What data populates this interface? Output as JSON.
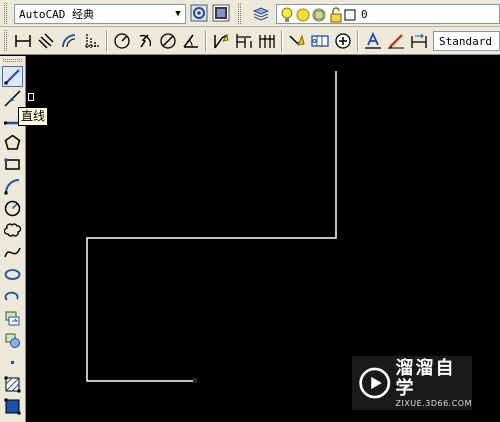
{
  "toolbar_top": {
    "workspace_value": "AutoCAD 经典",
    "layer_value": "0"
  },
  "dimension_toolbar": {
    "style_value": "Standard"
  },
  "draw_toolbar": {
    "tooltip": "直线"
  },
  "watermark": {
    "title": "溜溜自学",
    "url": "ZIXUE.3D66.COM"
  },
  "colors": {
    "toolbar_bg": "#ece9d8",
    "canvas_bg": "#000000",
    "line": "#ffffff",
    "icon_blue": "#1f4fa8"
  },
  "icons": {
    "top": [
      "workspace-settings-icon",
      "workspace-icon",
      "layer-manager-icon",
      "lightbulb-icon",
      "sun-icon",
      "layer-color-icon",
      "lock-icon",
      "color-square-icon"
    ],
    "dimension": [
      "linear-dim-icon",
      "aligned-dim-icon",
      "arc-length-icon",
      "ordinate-dim-icon",
      "radius-dim-icon",
      "jogged-dim-icon",
      "diameter-dim-icon",
      "angular-dim-icon",
      "quick-dim-icon",
      "baseline-dim-icon",
      "continue-dim-icon",
      "quick-leader-icon",
      "tolerance-icon",
      "center-mark-icon",
      "dim-edit-icon",
      "dim-text-edit-icon",
      "dim-update-icon"
    ],
    "draw": [
      "line-icon",
      "construction-line-icon",
      "polyline-icon",
      "polygon-icon",
      "rectangle-icon",
      "arc-icon",
      "circle-icon",
      "revision-cloud-icon",
      "spline-icon",
      "ellipse-icon",
      "ellipse-arc-icon",
      "insert-block-icon",
      "make-block-icon",
      "point-icon",
      "hatch-icon",
      "gradient-icon"
    ]
  }
}
